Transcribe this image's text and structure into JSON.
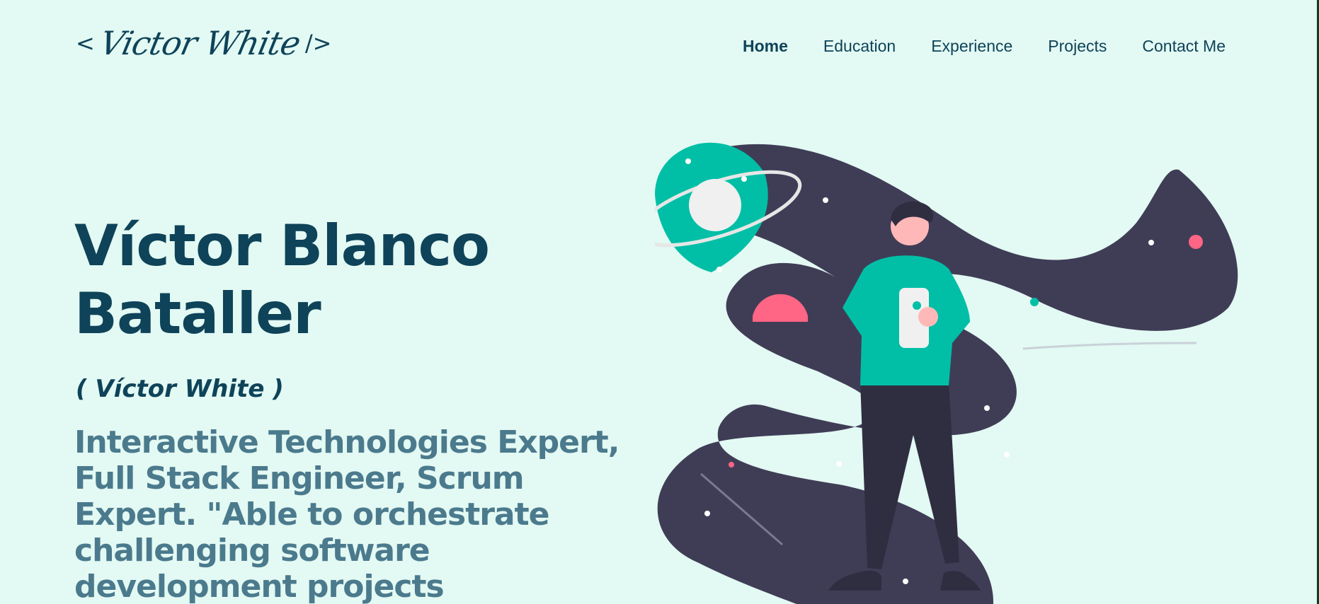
{
  "header": {
    "logo_left": "<",
    "logo_name": "Victor White",
    "logo_right": "/>"
  },
  "nav": {
    "items": [
      {
        "label": "Home",
        "active": true
      },
      {
        "label": "Education",
        "active": false
      },
      {
        "label": "Experience",
        "active": false
      },
      {
        "label": "Projects",
        "active": false
      },
      {
        "label": "Contact Me",
        "active": false
      }
    ]
  },
  "hero": {
    "name": "Víctor Blanco Bataller",
    "alias": "( Víctor White )",
    "description": "Interactive Technologies Expert, Full Stack Engineer, Scrum Expert. \"Able to orchestrate challenging software development projects"
  },
  "colors": {
    "background": "#e3f9f3",
    "primary_text": "#0e4359",
    "secondary_text": "#4b7a8d",
    "accent_teal": "#00bfa6",
    "accent_pink": "#ff6584",
    "space_dark": "#3f3d56"
  },
  "illustration": {
    "icon": "person-in-space-illustration"
  }
}
